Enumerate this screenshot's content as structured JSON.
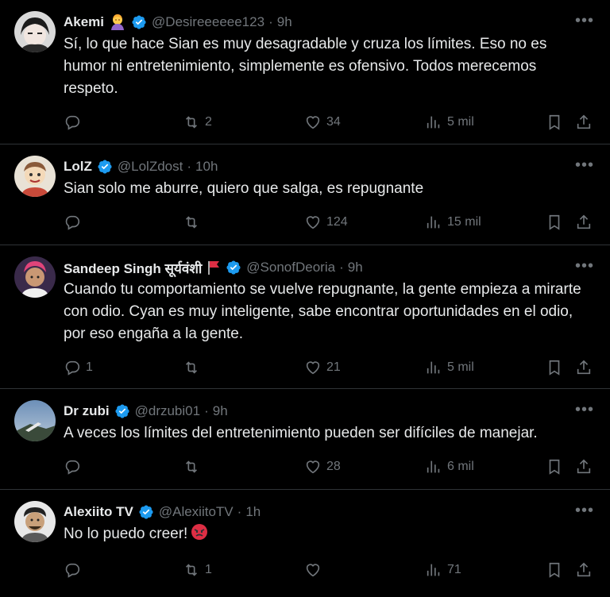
{
  "tweets": [
    {
      "name": "Akemi",
      "handle": "@Desireeeeee123",
      "time": "9h",
      "text": "Sí, lo que hace Sian es muy desagradable y cruza los límites. Eso no es humor ni entretenimiento, simplemente es ofensivo. Todos merecemos respeto.",
      "replies": "",
      "retweets": "2",
      "likes": "34",
      "views": "5 mil",
      "badge_icon": "person-tipping-hand-emoji"
    },
    {
      "name": "LolZ",
      "handle": "@LolZdost",
      "time": "10h",
      "text": "Sian solo me aburre, quiero que salga, es repugnante",
      "replies": "",
      "retweets": "",
      "likes": "124",
      "views": "15 mil"
    },
    {
      "name": "Sandeep Singh सूर्यवंशी",
      "handle": "@SonofDeoria",
      "time": "9h",
      "text": "Cuando tu comportamiento se vuelve repugnante, la gente empieza a mirarte con odio. Cyan es muy inteligente, sabe encontrar oportunidades en el odio, por eso engaña a la gente.",
      "replies": "1",
      "retweets": "",
      "likes": "21",
      "views": "5 mil",
      "badge_icon": "red-flag-emoji"
    },
    {
      "name": "Dr zubi",
      "handle": "@drzubi01",
      "time": "9h",
      "text": "A veces los límites del entretenimiento pueden ser difíciles de manejar.",
      "replies": "",
      "retweets": "",
      "likes": "28",
      "views": "6 mil"
    },
    {
      "name": "Alexiito TV",
      "handle": "@AlexiitoTV",
      "time": "1h",
      "text": "No lo puedo creer!",
      "replies": "",
      "retweets": "1",
      "likes": "",
      "views": "71",
      "text_emoji": "angry-face-emoji"
    }
  ],
  "separator": "·",
  "colors": {
    "background": "#000000",
    "text": "#e7e9ea",
    "muted": "#71767b",
    "verified": "#1d9bf0",
    "border": "#2f3336"
  }
}
